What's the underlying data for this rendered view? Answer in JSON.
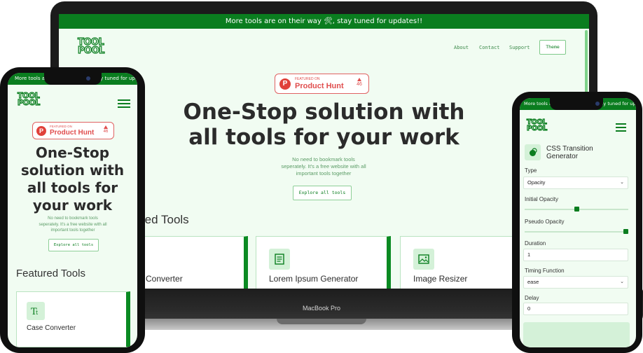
{
  "banner_text": "More tools are on their way 🛠, stay tuned for updates!!",
  "banner_text_left_phone": "More tools are on their way 🛠, stay tuned for updates!!",
  "banner_text_right_phone": "More tools are on their way 🛠, stay tuned for updates!!",
  "logo_line1": "TOOL",
  "logo_line2": "POOL",
  "nav": {
    "about": "About",
    "contact": "Contact",
    "support": "Support",
    "theme": "Theme"
  },
  "product_hunt": {
    "featured": "FEATURED ON",
    "name": "Product Hunt",
    "votes": "46",
    "letter": "P"
  },
  "hero": {
    "line1": "One-Stop solution with",
    "line2": "all tools for your work",
    "m_line1": "One-Stop",
    "m_line2": "solution with",
    "m_line3": "all tools for",
    "m_line4": "your work",
    "sub1": "No need to bookmark tools",
    "sub2": "seperately. It's a free website with all",
    "sub3": "important tools together",
    "explore": "Explore all tools"
  },
  "featured_title": "Featured Tools",
  "featured_title_partial": "red Tools",
  "cards": [
    {
      "title": "Converter",
      "icon": "case-icon"
    },
    {
      "title": "Lorem Ipsum Generator",
      "icon": "document-icon"
    },
    {
      "title": "Image Resizer",
      "icon": "image-icon"
    }
  ],
  "mobile_card": {
    "title": "Case Converter",
    "icon": "case-icon"
  },
  "laptop_model": "MacBook Pro",
  "css_tool": {
    "title_line1": "CSS Transition",
    "title_line2": "Generator",
    "type_label": "Type",
    "type_value": "Opacity",
    "initial_label": "Initial Opacity",
    "initial_value": 0.5,
    "pseudo_label": "Pseudo Opacity",
    "pseudo_value": 1,
    "duration_label": "Duration",
    "duration_value": "1",
    "timing_label": "Timing Function",
    "timing_value": "ease",
    "delay_label": "Delay",
    "delay_value": "0"
  },
  "colors": {
    "brand_green": "#0a7d1f",
    "background": "#f1fcf2",
    "product_hunt_red": "#e0413a"
  }
}
